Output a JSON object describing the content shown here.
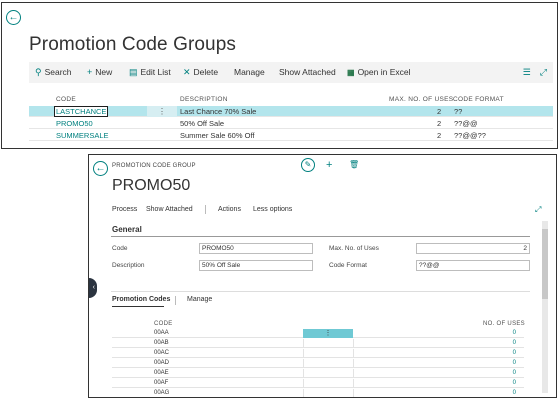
{
  "list_page": {
    "title": "Promotion Code Groups",
    "actions": {
      "search": "Search",
      "new": "New",
      "edit_list": "Edit List",
      "delete": "Delete",
      "manage": "Manage",
      "show_attached": "Show Attached",
      "open_excel": "Open in Excel"
    },
    "columns": {
      "code": "CODE",
      "description": "DESCRIPTION",
      "max_uses": "MAX. NO. OF USES",
      "code_format": "CODE FORMAT"
    },
    "rows": [
      {
        "code": "LASTCHANCE",
        "description": "Last Chance 70% Sale",
        "max_uses": "2",
        "code_format": "??"
      },
      {
        "code": "PROMO50",
        "description": "50% Off Sale",
        "max_uses": "2",
        "code_format": "??@@"
      },
      {
        "code": "SUMMERSALE",
        "description": "Summer Sale 60% Off",
        "max_uses": "2",
        "code_format": "??@@??"
      }
    ]
  },
  "card_page": {
    "breadcrumb": "PROMOTION CODE GROUP",
    "title": "PROMO50",
    "actions": {
      "process": "Process",
      "show_attached": "Show Attached",
      "actions": "Actions",
      "less_options": "Less options"
    },
    "section_title": "General",
    "fields": {
      "code_label": "Code",
      "code_value": "PROMO50",
      "description_label": "Description",
      "description_value": "50% Off Sale",
      "max_uses_label": "Max. No. of Uses",
      "max_uses_value": "2",
      "code_format_label": "Code Format",
      "code_format_value": "??@@"
    },
    "subpage": {
      "tab_codes": "Promotion Codes",
      "tab_manage": "Manage",
      "col_code": "CODE",
      "col_uses": "NO. OF USES",
      "rows": [
        {
          "code": "00AA",
          "uses": "0"
        },
        {
          "code": "00AB",
          "uses": "0"
        },
        {
          "code": "00AC",
          "uses": "0"
        },
        {
          "code": "00AD",
          "uses": "0"
        },
        {
          "code": "00AE",
          "uses": "0"
        },
        {
          "code": "00AF",
          "uses": "0"
        },
        {
          "code": "00AG",
          "uses": "0"
        }
      ]
    }
  },
  "colors": {
    "accent": "#00807f",
    "selected_row": "#b3e5ec",
    "excel_green": "#217346"
  }
}
